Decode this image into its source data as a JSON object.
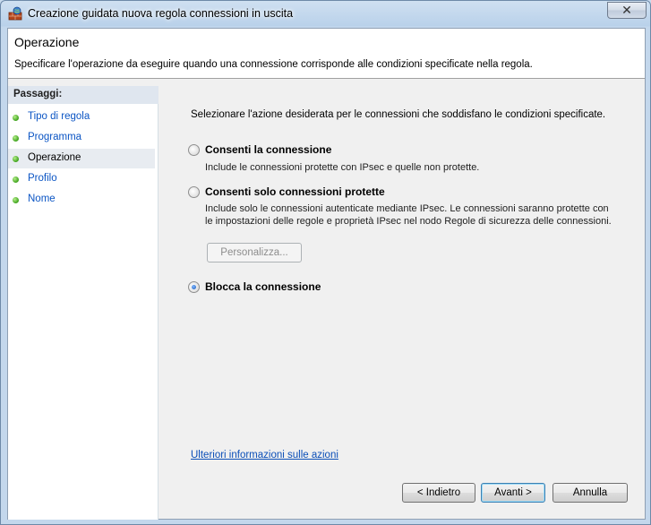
{
  "window": {
    "title": "Creazione guidata nuova regola connessioni in uscita",
    "close_symbol": "✕"
  },
  "header": {
    "title": "Operazione",
    "subtitle": "Specificare l'operazione da eseguire quando una connessione corrisponde alle condizioni specificate nella regola."
  },
  "steps": {
    "title": "Passaggi:",
    "items": [
      {
        "label": "Tipo di regola",
        "icon": "green-dot-icon"
      },
      {
        "label": "Programma",
        "icon": "green-dot-icon"
      },
      {
        "label": "Operazione",
        "icon": "green-dot-icon",
        "current": true
      },
      {
        "label": "Profilo",
        "icon": "green-dot-icon"
      },
      {
        "label": "Nome",
        "icon": "green-dot-icon"
      }
    ]
  },
  "main": {
    "instruction": "Selezionare l'azione desiderata per le connessioni che soddisfano le condizioni specificate.",
    "options": [
      {
        "label": "Consenti la connessione",
        "description": "Include le connessioni protette con IPsec e quelle non protette.",
        "checked": false
      },
      {
        "label": "Consenti solo connessioni protette",
        "description": "Include solo le connessioni autenticate mediante IPsec. Le connessioni saranno protette con le impostazioni delle regole e proprietà IPsec nel nodo Regole di sicurezza delle connessioni.",
        "checked": false
      },
      {
        "label": "Blocca la connessione",
        "description": "",
        "checked": true
      }
    ],
    "customize_button": "Personalizza...",
    "more_info_link": "Ulteriori informazioni sulle azioni"
  },
  "footer": {
    "back_button": "< Indietro",
    "next_button": "Avanti >",
    "cancel_button": "Annulla"
  }
}
